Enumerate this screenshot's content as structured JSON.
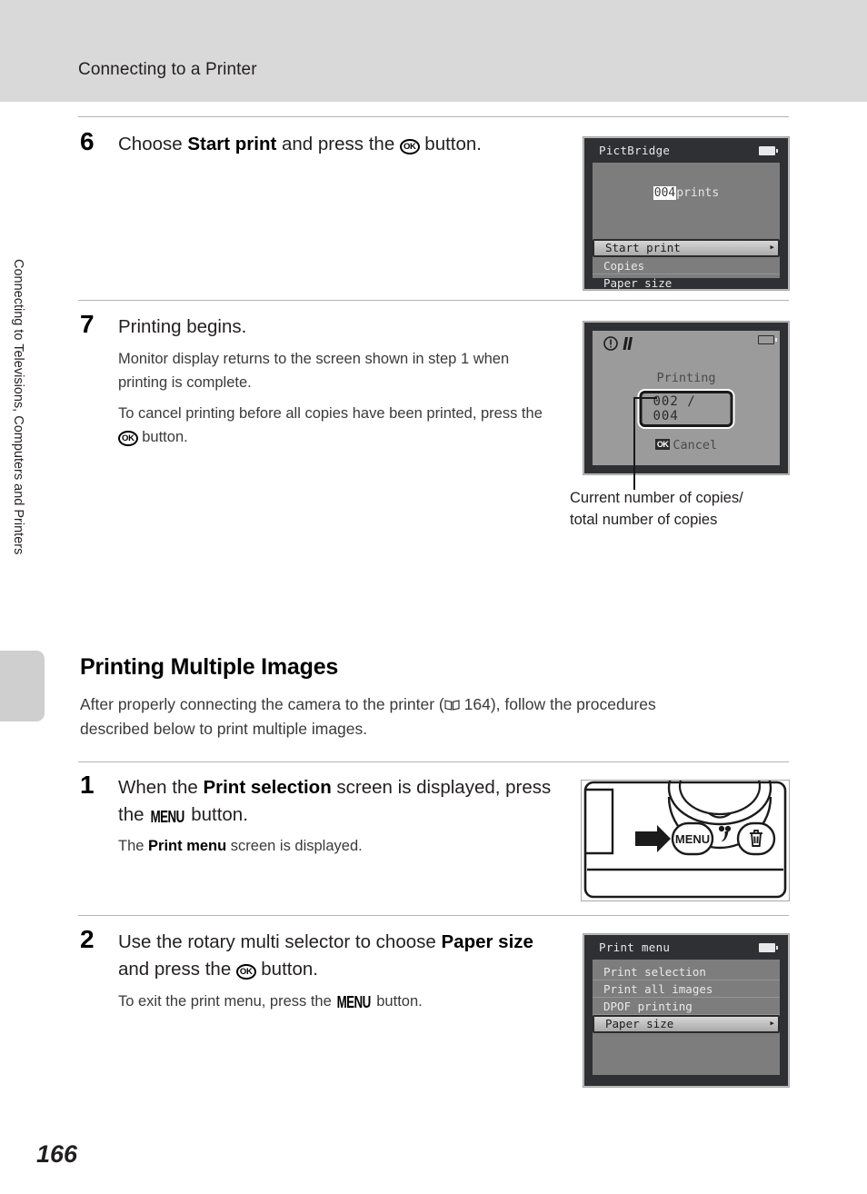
{
  "page": {
    "header_title": "Connecting to a Printer",
    "side_tab_text": "Connecting to Televisions, Computers and Printers",
    "page_number": "166"
  },
  "steps": {
    "step6": {
      "number": "6",
      "head_pre": "Choose ",
      "head_bold": "Start print",
      "head_mid": " and press the ",
      "head_ok": "OK",
      "head_post": " button."
    },
    "step7": {
      "number": "7",
      "head": "Printing begins.",
      "body1": "Monitor display returns to the screen shown in step 1 when printing is complete.",
      "body2_pre": "To cancel printing before all copies have been printed, press the ",
      "body2_ok": "OK",
      "body2_post": " button."
    },
    "step1": {
      "number": "1",
      "head_pre": "When the ",
      "head_bold": "Print selection",
      "head_mid": " screen is displayed, press the ",
      "head_menu": "MENU",
      "head_post": " button.",
      "body_pre": "The ",
      "body_bold": "Print menu",
      "body_post": " screen is displayed."
    },
    "step2": {
      "number": "2",
      "head_pre": "Use the rotary multi selector to choose ",
      "head_bold": "Paper size",
      "head_mid": " and press the ",
      "head_ok": "OK",
      "head_post": " button.",
      "body_pre": "To exit the print menu, press the ",
      "body_menu": "MENU",
      "body_post": " button."
    }
  },
  "section": {
    "heading": "Printing Multiple Images",
    "body_pre": "After properly connecting the camera to the printer (",
    "body_ref": " 164), follow the procedures described below to print multiple images.",
    "ref_page": "164"
  },
  "screens": {
    "pictbridge": {
      "title": "PictBridge",
      "count": "004",
      "count_unit": "prints",
      "items": [
        {
          "label": "Start print",
          "selected": true
        },
        {
          "label": "Copies",
          "selected": false
        },
        {
          "label": "Paper size",
          "selected": false
        }
      ],
      "battery_icon": "battery-full-icon"
    },
    "printing": {
      "warning_icons": [
        "exclamation-circle-icon",
        "shake-warning-icon"
      ],
      "label": "Printing",
      "progress": "002 / 004",
      "cancel_badge": "OK",
      "cancel_label": "Cancel",
      "battery_icon": "battery-empty-icon"
    },
    "print_menu": {
      "title": "Print menu",
      "items": [
        {
          "label": "Print selection",
          "selected": false
        },
        {
          "label": "Print all images",
          "selected": false
        },
        {
          "label": "DPOF printing",
          "selected": false
        },
        {
          "label": "Paper size",
          "selected": true
        }
      ],
      "battery_icon": "battery-full-icon"
    }
  },
  "callout": {
    "line1": "Current number of copies/",
    "line2": "total number of copies"
  },
  "camera_illustration": {
    "menu_button_label": "MENU",
    "macro_icon": "macro-flower-icon",
    "delete_icon": "trash-can-icon",
    "pointer_icon": "right-arrow-icon"
  }
}
